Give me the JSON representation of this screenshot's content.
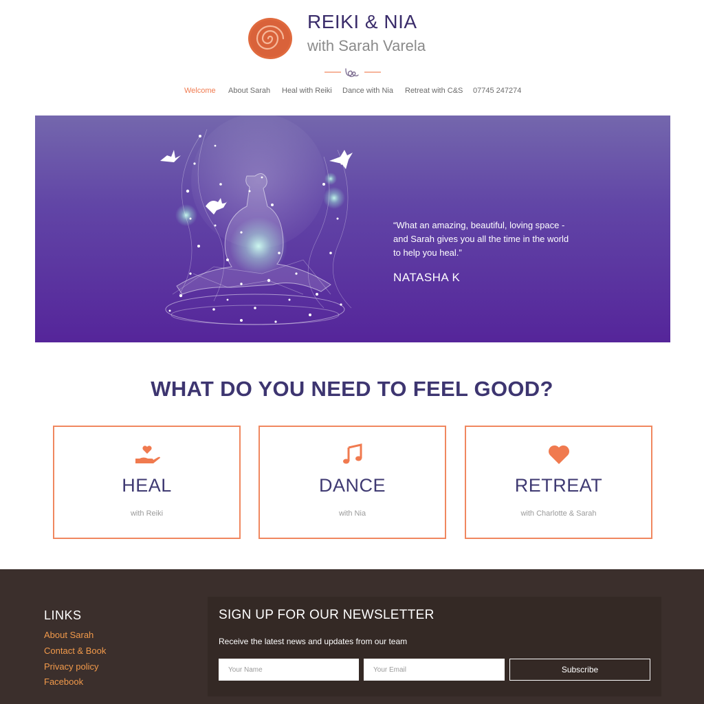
{
  "brand": {
    "title": "REIKI & NIA",
    "subtitle": "with Sarah Varela",
    "logo_icon": "spiral-logo-icon",
    "accent_color": "#f07a4f",
    "primary_color": "#3d2e6b"
  },
  "nav": {
    "items": [
      {
        "label": "Welcome",
        "active": true
      },
      {
        "label": "About Sarah",
        "active": false
      },
      {
        "label": "Heal with Reiki",
        "active": false
      },
      {
        "label": "Dance with Nia",
        "active": false
      },
      {
        "label": "Retreat with C&S",
        "active": false
      },
      {
        "label": "07745 247274",
        "active": false
      }
    ]
  },
  "hero": {
    "quote": "“What an amazing, beautiful, loving space - and Sarah gives you all the time in the world to help you heal.”",
    "author": "NATASHA K",
    "background_top": "#7467ad",
    "background_bottom": "#55259a"
  },
  "section": {
    "heading": "WHAT DO YOU NEED TO FEEL GOOD?"
  },
  "cards": [
    {
      "title": "HEAL",
      "subtitle": "with Reiki",
      "icon": "heart-hand-icon"
    },
    {
      "title": "DANCE",
      "subtitle": "with Nia",
      "icon": "music-note-icon"
    },
    {
      "title": "RETREAT",
      "subtitle": "with Charlotte & Sarah",
      "icon": "heart-icon"
    }
  ],
  "footer": {
    "links_heading": "LINKS",
    "links": [
      "About Sarah",
      "Contact & Book",
      "Privacy policy",
      "Facebook"
    ],
    "link_color": "#f29a4b",
    "background": "#3b2f2c"
  },
  "newsletter": {
    "heading": "SIGN UP FOR OUR NEWSLETTER",
    "description": "Receive the latest news and updates from our team",
    "name_placeholder": "Your Name",
    "email_placeholder": "Your Email",
    "button_label": "Subscribe"
  }
}
